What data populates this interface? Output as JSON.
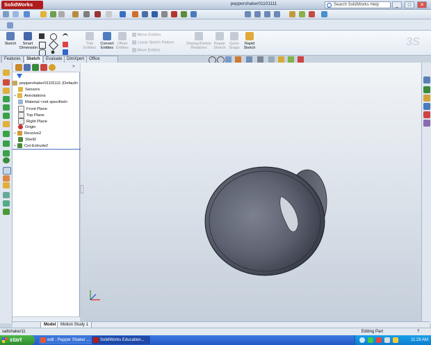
{
  "app": {
    "logo": "SolidWorks",
    "doc_title": "peppershaker01101111",
    "help_search_placeholder": "Search SolidWorks Help"
  },
  "window_buttons": [
    "_",
    "□",
    "✕"
  ],
  "command_manager": {
    "items": [
      {
        "label": "Sketch",
        "enabled": true
      },
      {
        "label": "Smart Dimension",
        "enabled": true
      },
      {
        "label": "Trim Entities",
        "enabled": false
      },
      {
        "label": "Convert Entities",
        "enabled": true
      },
      {
        "label": "Offset Entities",
        "enabled": false
      },
      {
        "label": "Display/Delete Relations",
        "enabled": false
      },
      {
        "label": "Repair Sketch",
        "enabled": false
      },
      {
        "label": "Quick Snaps",
        "enabled": false
      },
      {
        "label": "Rapid Sketch",
        "enabled": true
      }
    ],
    "mirror_label": "Mirror Entities",
    "linear_pattern_label": "Linear Sketch Pattern",
    "move_label": "Move Entities"
  },
  "command_tabs": [
    "Features",
    "Sketch",
    "Evaluate",
    "DimXpert",
    "Office Products"
  ],
  "active_tab": "Sketch",
  "feature_tree": {
    "root": "peppershaker01101111 (Default<",
    "nodes": [
      "Sensors",
      "Annotations",
      "Material <not specified>",
      "Front Plane",
      "Top Plane",
      "Right Plane",
      "Origin",
      "Revolve2",
      "Shell2",
      "Cut-Extrude2"
    ]
  },
  "model_tabs": [
    "Model",
    "Motion Study 1"
  ],
  "status": {
    "left": "saltshaker11",
    "right": "Editing Part",
    "help": "?"
  },
  "taskbar": {
    "start": "start",
    "tasks": [
      "edit : Pepper Shaker ...",
      "SolidWorks Education..."
    ],
    "clock": "11:29 AM"
  },
  "colors": {
    "accent": "#2557c8",
    "logo": "#b01c1c",
    "model": "#5a5f6e"
  }
}
